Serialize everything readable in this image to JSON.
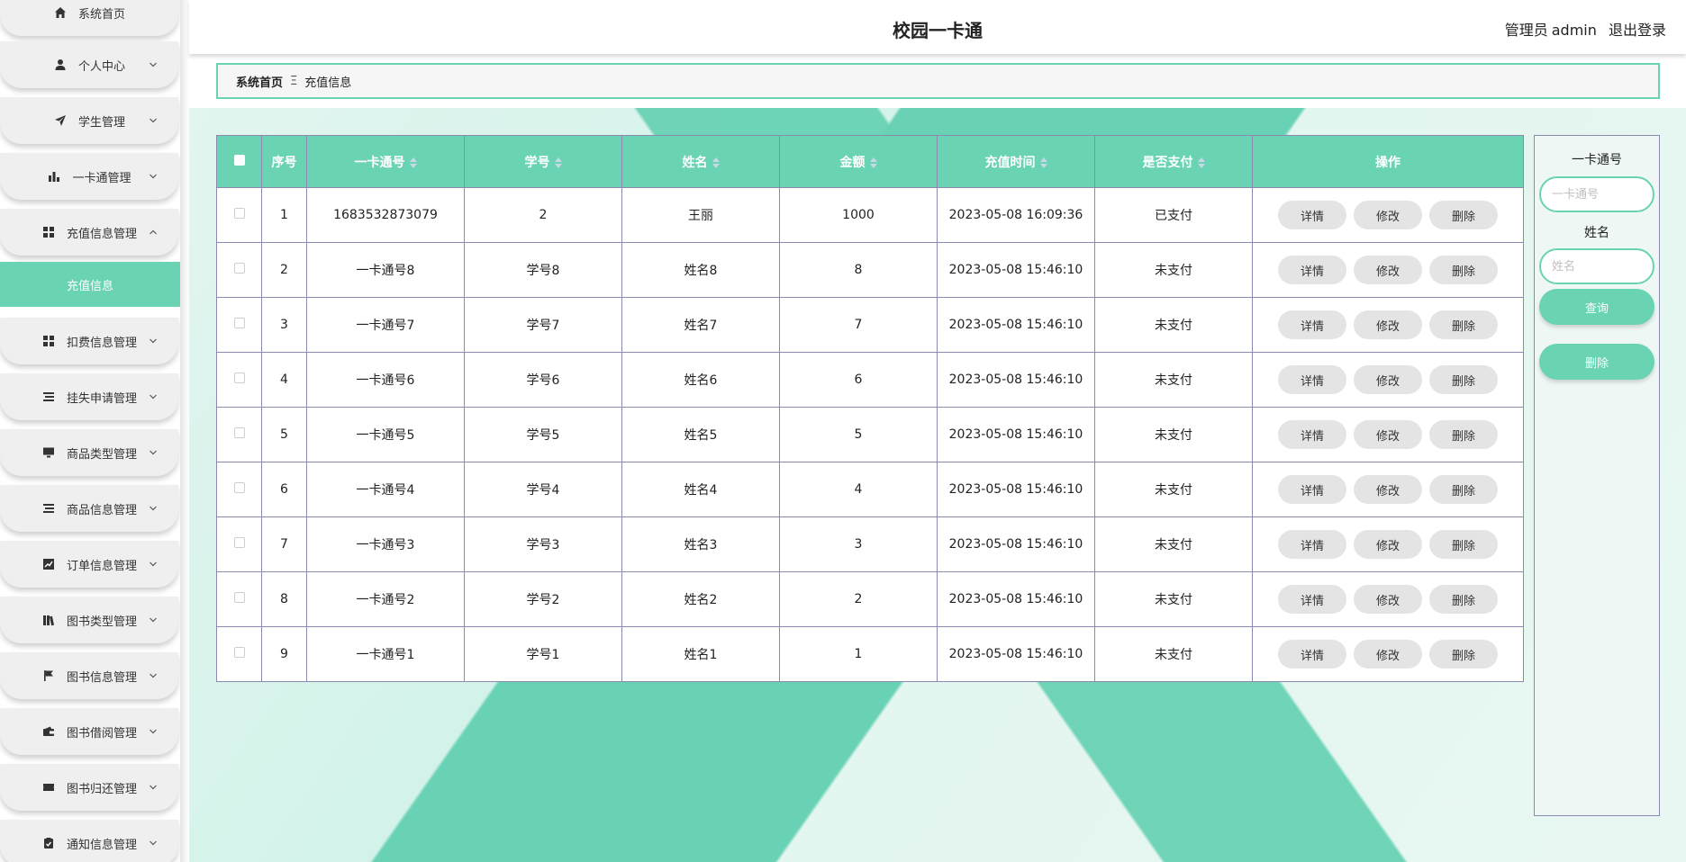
{
  "app": {
    "title": "校园一卡通"
  },
  "header": {
    "user_role": "管理员",
    "user_name": "admin",
    "logout": "退出登录"
  },
  "breadcrumb": {
    "home": "系统首页",
    "separator": "Ξ",
    "current": "充值信息"
  },
  "sidebar": {
    "items": [
      {
        "label": "系统首页",
        "icon": "home-icon"
      },
      {
        "label": "个人中心",
        "icon": "user-icon"
      },
      {
        "label": "学生管理",
        "icon": "send-icon"
      },
      {
        "label": "一卡通管理",
        "icon": "bar-chart-icon"
      },
      {
        "label": "充值信息管理",
        "icon": "grid-icon"
      },
      {
        "label": "扣费信息管理",
        "icon": "grid-icon"
      },
      {
        "label": "挂失申请管理",
        "icon": "list-icon"
      },
      {
        "label": "商品类型管理",
        "icon": "monitor-icon"
      },
      {
        "label": "商品信息管理",
        "icon": "list-icon"
      },
      {
        "label": "订单信息管理",
        "icon": "line-chart-icon"
      },
      {
        "label": "图书类型管理",
        "icon": "books-icon"
      },
      {
        "label": "图书信息管理",
        "icon": "flag-icon"
      },
      {
        "label": "图书借阅管理",
        "icon": "wallet-icon"
      },
      {
        "label": "图书归还管理",
        "icon": "ticket-icon"
      },
      {
        "label": "通知信息管理",
        "icon": "clipboard-icon"
      }
    ],
    "active_sub": "充值信息"
  },
  "table": {
    "headers": [
      "序号",
      "一卡通号",
      "学号",
      "姓名",
      "金额",
      "充值时间",
      "是否支付",
      "操作"
    ],
    "rows": [
      [
        "1",
        "1683532873079",
        "2",
        "王丽",
        "1000",
        "2023-05-08 16:09:36",
        "已支付"
      ],
      [
        "2",
        "一卡通号8",
        "学号8",
        "姓名8",
        "8",
        "2023-05-08 15:46:10",
        "未支付"
      ],
      [
        "3",
        "一卡通号7",
        "学号7",
        "姓名7",
        "7",
        "2023-05-08 15:46:10",
        "未支付"
      ],
      [
        "4",
        "一卡通号6",
        "学号6",
        "姓名6",
        "6",
        "2023-05-08 15:46:10",
        "未支付"
      ],
      [
        "5",
        "一卡通号5",
        "学号5",
        "姓名5",
        "5",
        "2023-05-08 15:46:10",
        "未支付"
      ],
      [
        "6",
        "一卡通号4",
        "学号4",
        "姓名4",
        "4",
        "2023-05-08 15:46:10",
        "未支付"
      ],
      [
        "7",
        "一卡通号3",
        "学号3",
        "姓名3",
        "3",
        "2023-05-08 15:46:10",
        "未支付"
      ],
      [
        "8",
        "一卡通号2",
        "学号2",
        "姓名2",
        "2",
        "2023-05-08 15:46:10",
        "未支付"
      ],
      [
        "9",
        "一卡通号1",
        "学号1",
        "姓名1",
        "1",
        "2023-05-08 15:46:10",
        "未支付"
      ]
    ],
    "actions": {
      "detail": "详情",
      "edit": "修改",
      "delete": "删除"
    }
  },
  "search": {
    "card_label": "一卡通号",
    "card_placeholder": "一卡通号",
    "name_label": "姓名",
    "name_placeholder": "姓名",
    "query_button": "查询",
    "delete_button": "删除"
  },
  "colors": {
    "accent": "#6ad3b3",
    "button_gray": "#e4e4e4",
    "border": "#8a8ab0"
  }
}
